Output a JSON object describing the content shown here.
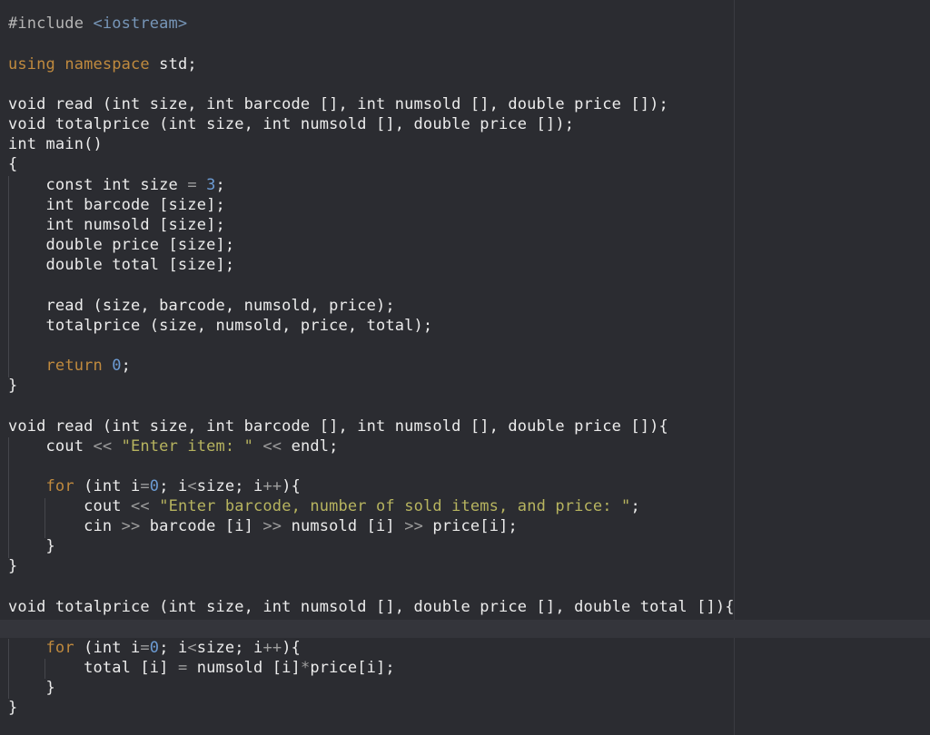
{
  "editor": {
    "colors": {
      "background": "#2b2c31",
      "text": "#ececec",
      "keyword": "#c08a3e",
      "number": "#6c9bd3",
      "string": "#b7b45f",
      "operator": "#9e9e9e",
      "include_path": "#7796b8",
      "current_line_highlight": "#34353b"
    },
    "lines": [
      {
        "tokens": [
          {
            "t": "#include ",
            "c": "pre"
          },
          {
            "t": "<iostream>",
            "c": "inc"
          }
        ]
      },
      {
        "tokens": [
          {
            "t": "using",
            "c": "kw"
          },
          {
            "t": " ",
            "c": "id"
          },
          {
            "t": "namespace",
            "c": "kw"
          },
          {
            "t": " std;",
            "c": "id"
          }
        ]
      },
      {
        "tokens": [
          {
            "t": "void read (int size, int barcode [], int numsold [], double price []);",
            "c": "id"
          }
        ]
      },
      {
        "tokens": [
          {
            "t": "void totalprice (int size, int numsold [], double price []);",
            "c": "id"
          }
        ]
      },
      {
        "tokens": [
          {
            "t": "int main()",
            "c": "id"
          }
        ]
      },
      {
        "tokens": [
          {
            "t": "{",
            "c": "id"
          }
        ]
      },
      {
        "tokens": [
          {
            "t": "    const int size ",
            "c": "id"
          },
          {
            "t": "=",
            "c": "op"
          },
          {
            "t": " ",
            "c": "id"
          },
          {
            "t": "3",
            "c": "num"
          },
          {
            "t": ";",
            "c": "id"
          }
        ]
      },
      {
        "tokens": [
          {
            "t": "    int barcode [size];",
            "c": "id"
          }
        ]
      },
      {
        "tokens": [
          {
            "t": "    int numsold [size];",
            "c": "id"
          }
        ]
      },
      {
        "tokens": [
          {
            "t": "    double price [size];",
            "c": "id"
          }
        ]
      },
      {
        "tokens": [
          {
            "t": "    double total [size];",
            "c": "id"
          }
        ]
      },
      {
        "tokens": [
          {
            "t": "    read (size, barcode, numsold, price);",
            "c": "id"
          }
        ]
      },
      {
        "tokens": [
          {
            "t": "    totalprice (size, numsold, price, total);",
            "c": "id"
          }
        ]
      },
      {
        "tokens": [
          {
            "t": "    ",
            "c": "id"
          },
          {
            "t": "return",
            "c": "kw"
          },
          {
            "t": " ",
            "c": "id"
          },
          {
            "t": "0",
            "c": "num"
          },
          {
            "t": ";",
            "c": "id"
          }
        ]
      },
      {
        "tokens": [
          {
            "t": "}",
            "c": "id"
          }
        ]
      },
      {
        "tokens": [
          {
            "t": "void read (int size, int barcode [], int numsold [], double price []){",
            "c": "id"
          }
        ]
      },
      {
        "tokens": [
          {
            "t": "    cout ",
            "c": "id"
          },
          {
            "t": "<<",
            "c": "op"
          },
          {
            "t": " ",
            "c": "id"
          },
          {
            "t": "\"Enter item: \"",
            "c": "str"
          },
          {
            "t": " ",
            "c": "id"
          },
          {
            "t": "<<",
            "c": "op"
          },
          {
            "t": " endl;",
            "c": "id"
          }
        ]
      },
      {
        "tokens": [
          {
            "t": "    ",
            "c": "id"
          },
          {
            "t": "for",
            "c": "kw"
          },
          {
            "t": " (int i",
            "c": "id"
          },
          {
            "t": "=",
            "c": "op"
          },
          {
            "t": "0",
            "c": "num"
          },
          {
            "t": "; i",
            "c": "id"
          },
          {
            "t": "<",
            "c": "op"
          },
          {
            "t": "size; i",
            "c": "id"
          },
          {
            "t": "++",
            "c": "op"
          },
          {
            "t": "){",
            "c": "id"
          }
        ]
      },
      {
        "tokens": [
          {
            "t": "        cout ",
            "c": "id"
          },
          {
            "t": "<<",
            "c": "op"
          },
          {
            "t": " ",
            "c": "id"
          },
          {
            "t": "\"Enter barcode, number of sold items, and price: \"",
            "c": "str"
          },
          {
            "t": ";",
            "c": "id"
          }
        ]
      },
      {
        "tokens": [
          {
            "t": "        cin ",
            "c": "id"
          },
          {
            "t": ">>",
            "c": "op"
          },
          {
            "t": " barcode [i] ",
            "c": "id"
          },
          {
            "t": ">>",
            "c": "op"
          },
          {
            "t": " numsold [i] ",
            "c": "id"
          },
          {
            "t": ">>",
            "c": "op"
          },
          {
            "t": " price[i];",
            "c": "id"
          }
        ]
      },
      {
        "tokens": [
          {
            "t": "    }",
            "c": "id"
          }
        ]
      },
      {
        "tokens": [
          {
            "t": "}",
            "c": "id"
          }
        ]
      },
      {
        "tokens": [
          {
            "t": "void totalprice (int size, int numsold [], double price [], double total []){",
            "c": "id"
          }
        ]
      },
      {
        "tokens": [
          {
            "t": "    ",
            "c": "id"
          },
          {
            "t": "for",
            "c": "kw"
          },
          {
            "t": " (int i",
            "c": "id"
          },
          {
            "t": "=",
            "c": "op"
          },
          {
            "t": "0",
            "c": "num"
          },
          {
            "t": "; i",
            "c": "id"
          },
          {
            "t": "<",
            "c": "op"
          },
          {
            "t": "size; i",
            "c": "id"
          },
          {
            "t": "++",
            "c": "op"
          },
          {
            "t": "){",
            "c": "id"
          }
        ]
      },
      {
        "tokens": [
          {
            "t": "        total [i] ",
            "c": "id"
          },
          {
            "t": "=",
            "c": "op"
          },
          {
            "t": " numsold [i]",
            "c": "id"
          },
          {
            "t": "*",
            "c": "op"
          },
          {
            "t": "price[i];",
            "c": "id"
          }
        ]
      },
      {
        "tokens": [
          {
            "t": "    }",
            "c": "id"
          }
        ]
      },
      {
        "tokens": [
          {
            "t": "}",
            "c": "id"
          }
        ]
      }
    ]
  }
}
